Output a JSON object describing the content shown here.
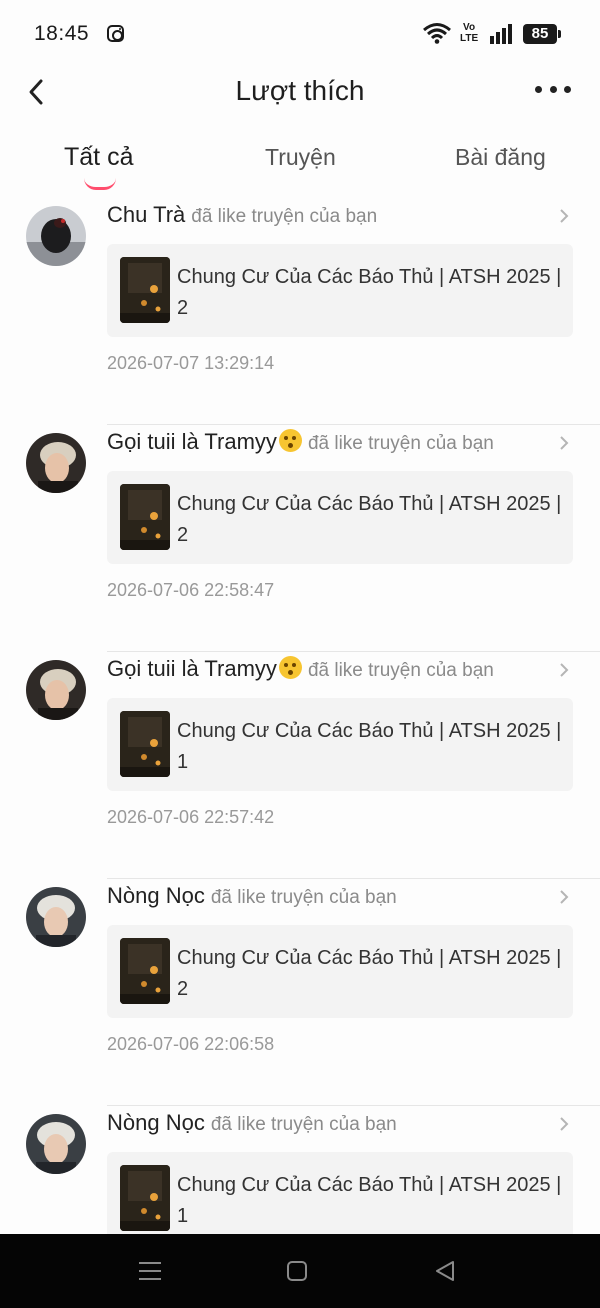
{
  "status_bar": {
    "time": "18:45",
    "instagram_icon": "instagram-icon",
    "network_top": "Vo",
    "network_bottom": "LTE",
    "battery": "85"
  },
  "header": {
    "back_icon": "back-arrow-icon",
    "title": "Lượt thích",
    "more_icon": "more-dots-icon"
  },
  "tabs": [
    {
      "label": "Tất cả",
      "active": true
    },
    {
      "label": "Truyện",
      "active": false
    },
    {
      "label": "Bài đăng",
      "active": false
    }
  ],
  "accent_color": "#ff4d6d",
  "notifications": [
    {
      "user": "Chu Trà",
      "emoji": false,
      "action": "đã like truyện của bạn",
      "story": "Chung Cư Của Các Báo Thủ | ATSH 2025 | 2",
      "timestamp": "2026-07-07 13:29:14"
    },
    {
      "user": "Gọi tuii là Tramyy",
      "emoji": true,
      "action": "đã like truyện của bạn",
      "story": "Chung Cư Của Các Báo Thủ | ATSH 2025 | 2",
      "timestamp": "2026-07-06 22:58:47"
    },
    {
      "user": "Gọi tuii là Tramyy",
      "emoji": true,
      "action": "đã like truyện của bạn",
      "story": "Chung Cư Của Các Báo Thủ | ATSH 2025 | 1",
      "timestamp": "2026-07-06 22:57:42"
    },
    {
      "user": "Nòng Nọc",
      "emoji": false,
      "action": "đã like truyện của bạn",
      "story": "Chung Cư Của Các Báo Thủ | ATSH 2025 | 2",
      "timestamp": "2026-07-06 22:06:58"
    },
    {
      "user": "Nòng Nọc",
      "emoji": false,
      "action": "đã like truyện của bạn",
      "story": "Chung Cư Của Các Báo Thủ | ATSH 2025 | 1",
      "timestamp": ""
    }
  ],
  "nav_bar": {
    "menu_icon": "menu-lines-icon",
    "home_icon": "home-square-icon",
    "back_icon": "back-triangle-icon"
  }
}
